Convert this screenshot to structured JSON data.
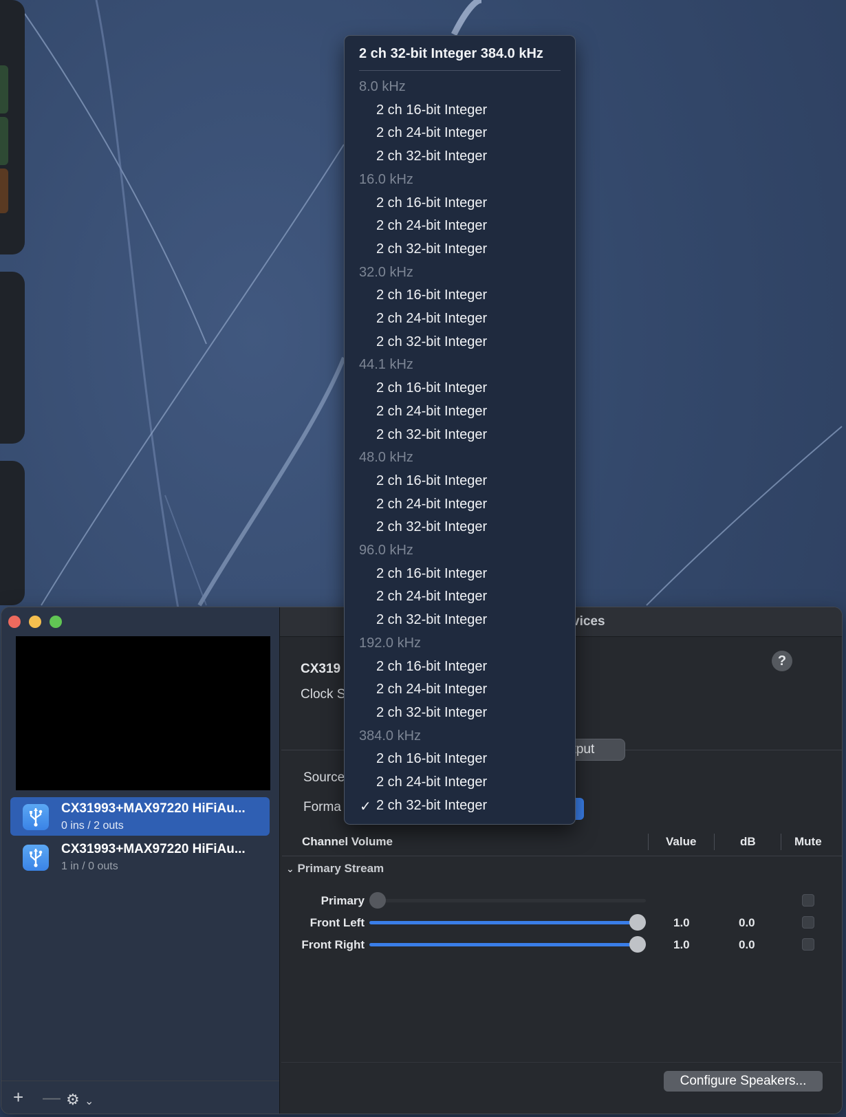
{
  "window": {
    "title_fragment": "vices",
    "device_title_fragment": "CX319",
    "clock_label_fragment": "Clock S",
    "output_tab_fragment": "utput",
    "source_label_fragment": "Source",
    "format_label_fragment": "Forma",
    "help_label": "?"
  },
  "sidebar": {
    "devices": [
      {
        "name": "CX31993+MAX97220 HiFiAu...",
        "io": "0 ins / 2 outs",
        "selected": true
      },
      {
        "name": "CX31993+MAX97220 HiFiAu...",
        "io": "1 in / 0 outs",
        "selected": false
      }
    ],
    "footer": {
      "add": "+",
      "remove": "—",
      "gear": "⚙",
      "chevron": "⌄"
    }
  },
  "format_menu": {
    "current": "2 ch 32-bit Integer 384.0 kHz",
    "sections": [
      {
        "rate": "8.0 kHz",
        "options": [
          "2 ch 16-bit Integer",
          "2 ch 24-bit Integer",
          "2 ch 32-bit Integer"
        ]
      },
      {
        "rate": "16.0 kHz",
        "options": [
          "2 ch 16-bit Integer",
          "2 ch 24-bit Integer",
          "2 ch 32-bit Integer"
        ]
      },
      {
        "rate": "32.0 kHz",
        "options": [
          "2 ch 16-bit Integer",
          "2 ch 24-bit Integer",
          "2 ch 32-bit Integer"
        ]
      },
      {
        "rate": "44.1 kHz",
        "options": [
          "2 ch 16-bit Integer",
          "2 ch 24-bit Integer",
          "2 ch 32-bit Integer"
        ]
      },
      {
        "rate": "48.0 kHz",
        "options": [
          "2 ch 16-bit Integer",
          "2 ch 24-bit Integer",
          "2 ch 32-bit Integer"
        ]
      },
      {
        "rate": "96.0 kHz",
        "options": [
          "2 ch 16-bit Integer",
          "2 ch 24-bit Integer",
          "2 ch 32-bit Integer"
        ]
      },
      {
        "rate": "192.0 kHz",
        "options": [
          "2 ch 16-bit Integer",
          "2 ch 24-bit Integer",
          "2 ch 32-bit Integer"
        ]
      },
      {
        "rate": "384.0 kHz",
        "options": [
          "2 ch 16-bit Integer",
          "2 ch 24-bit Integer",
          "2 ch 32-bit Integer"
        ]
      }
    ],
    "checked_mark": "✓"
  },
  "volume_table": {
    "headers": {
      "channel": "Channel Volume",
      "value": "Value",
      "db": "dB",
      "mute": "Mute"
    },
    "stream": "Primary Stream",
    "rows": [
      {
        "label": "Primary",
        "level": 0.0,
        "value": "",
        "db": "",
        "enabled": false
      },
      {
        "label": "Front Left",
        "level": 1.0,
        "value": "1.0",
        "db": "0.0",
        "enabled": true
      },
      {
        "label": "Front Right",
        "level": 1.0,
        "value": "1.0",
        "db": "0.0",
        "enabled": true
      }
    ]
  },
  "buttons": {
    "configure_speakers": "Configure Speakers..."
  },
  "colors": {
    "accent": "#3a7ee8",
    "selection": "#2f5fb3",
    "menu_bg": "#1f2a3e"
  }
}
